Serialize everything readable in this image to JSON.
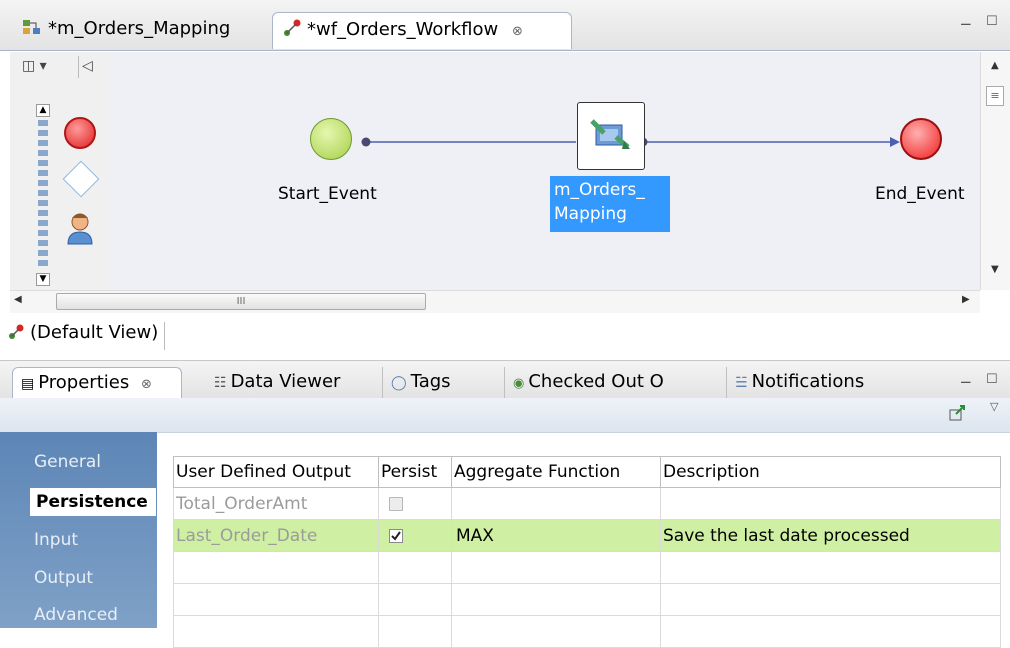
{
  "editor_tabs": [
    {
      "label": "*m_Orders_Mapping",
      "icon": "mapping-icon",
      "active": false
    },
    {
      "label": "*wf_Orders_Workflow",
      "icon": "workflow-icon",
      "active": true,
      "close": "⊗"
    }
  ],
  "palette": {
    "tools": [
      "start-event-icon",
      "end-event-icon",
      "gateway-icon",
      "human-task-icon"
    ]
  },
  "workflow": {
    "nodes": {
      "start": {
        "label": "Start_Event"
      },
      "mapping": {
        "label_line1": "m_Orders_",
        "label_line2": "Mapping"
      },
      "end": {
        "label": "End_Event"
      }
    }
  },
  "scroll": {
    "hmarker": "III"
  },
  "view_label": "(Default View)",
  "bottom_tabs": [
    {
      "label": "Properties",
      "icon": "properties-icon",
      "active": true,
      "close": "⊗"
    },
    {
      "label": "Data Viewer",
      "icon": "data-viewer-icon"
    },
    {
      "label": "Tags",
      "icon": "tag-icon"
    },
    {
      "label": "Checked Out O",
      "icon": "checked-out-icon"
    },
    {
      "label": "Notifications",
      "icon": "notifications-icon"
    }
  ],
  "properties": {
    "sections": [
      {
        "label": "General",
        "active": false
      },
      {
        "label": "Persistence",
        "active": true
      },
      {
        "label": "Input",
        "active": false
      },
      {
        "label": "Output",
        "active": false
      },
      {
        "label": "Advanced",
        "active": false
      }
    ],
    "table": {
      "columns": [
        "User Defined Output",
        "Persist",
        "Aggregate Function",
        "Description"
      ],
      "rows": [
        {
          "output": "Total_OrderAmt",
          "persist": false,
          "aggregate": "",
          "description": ""
        },
        {
          "output": "Last_Order_Date",
          "persist": true,
          "aggregate": "MAX",
          "description": "Save the last date processed"
        }
      ]
    }
  },
  "colors": {
    "selection": "#3399ff",
    "row_highlight": "#cff0a2",
    "sidebar": "#6a90bd"
  }
}
